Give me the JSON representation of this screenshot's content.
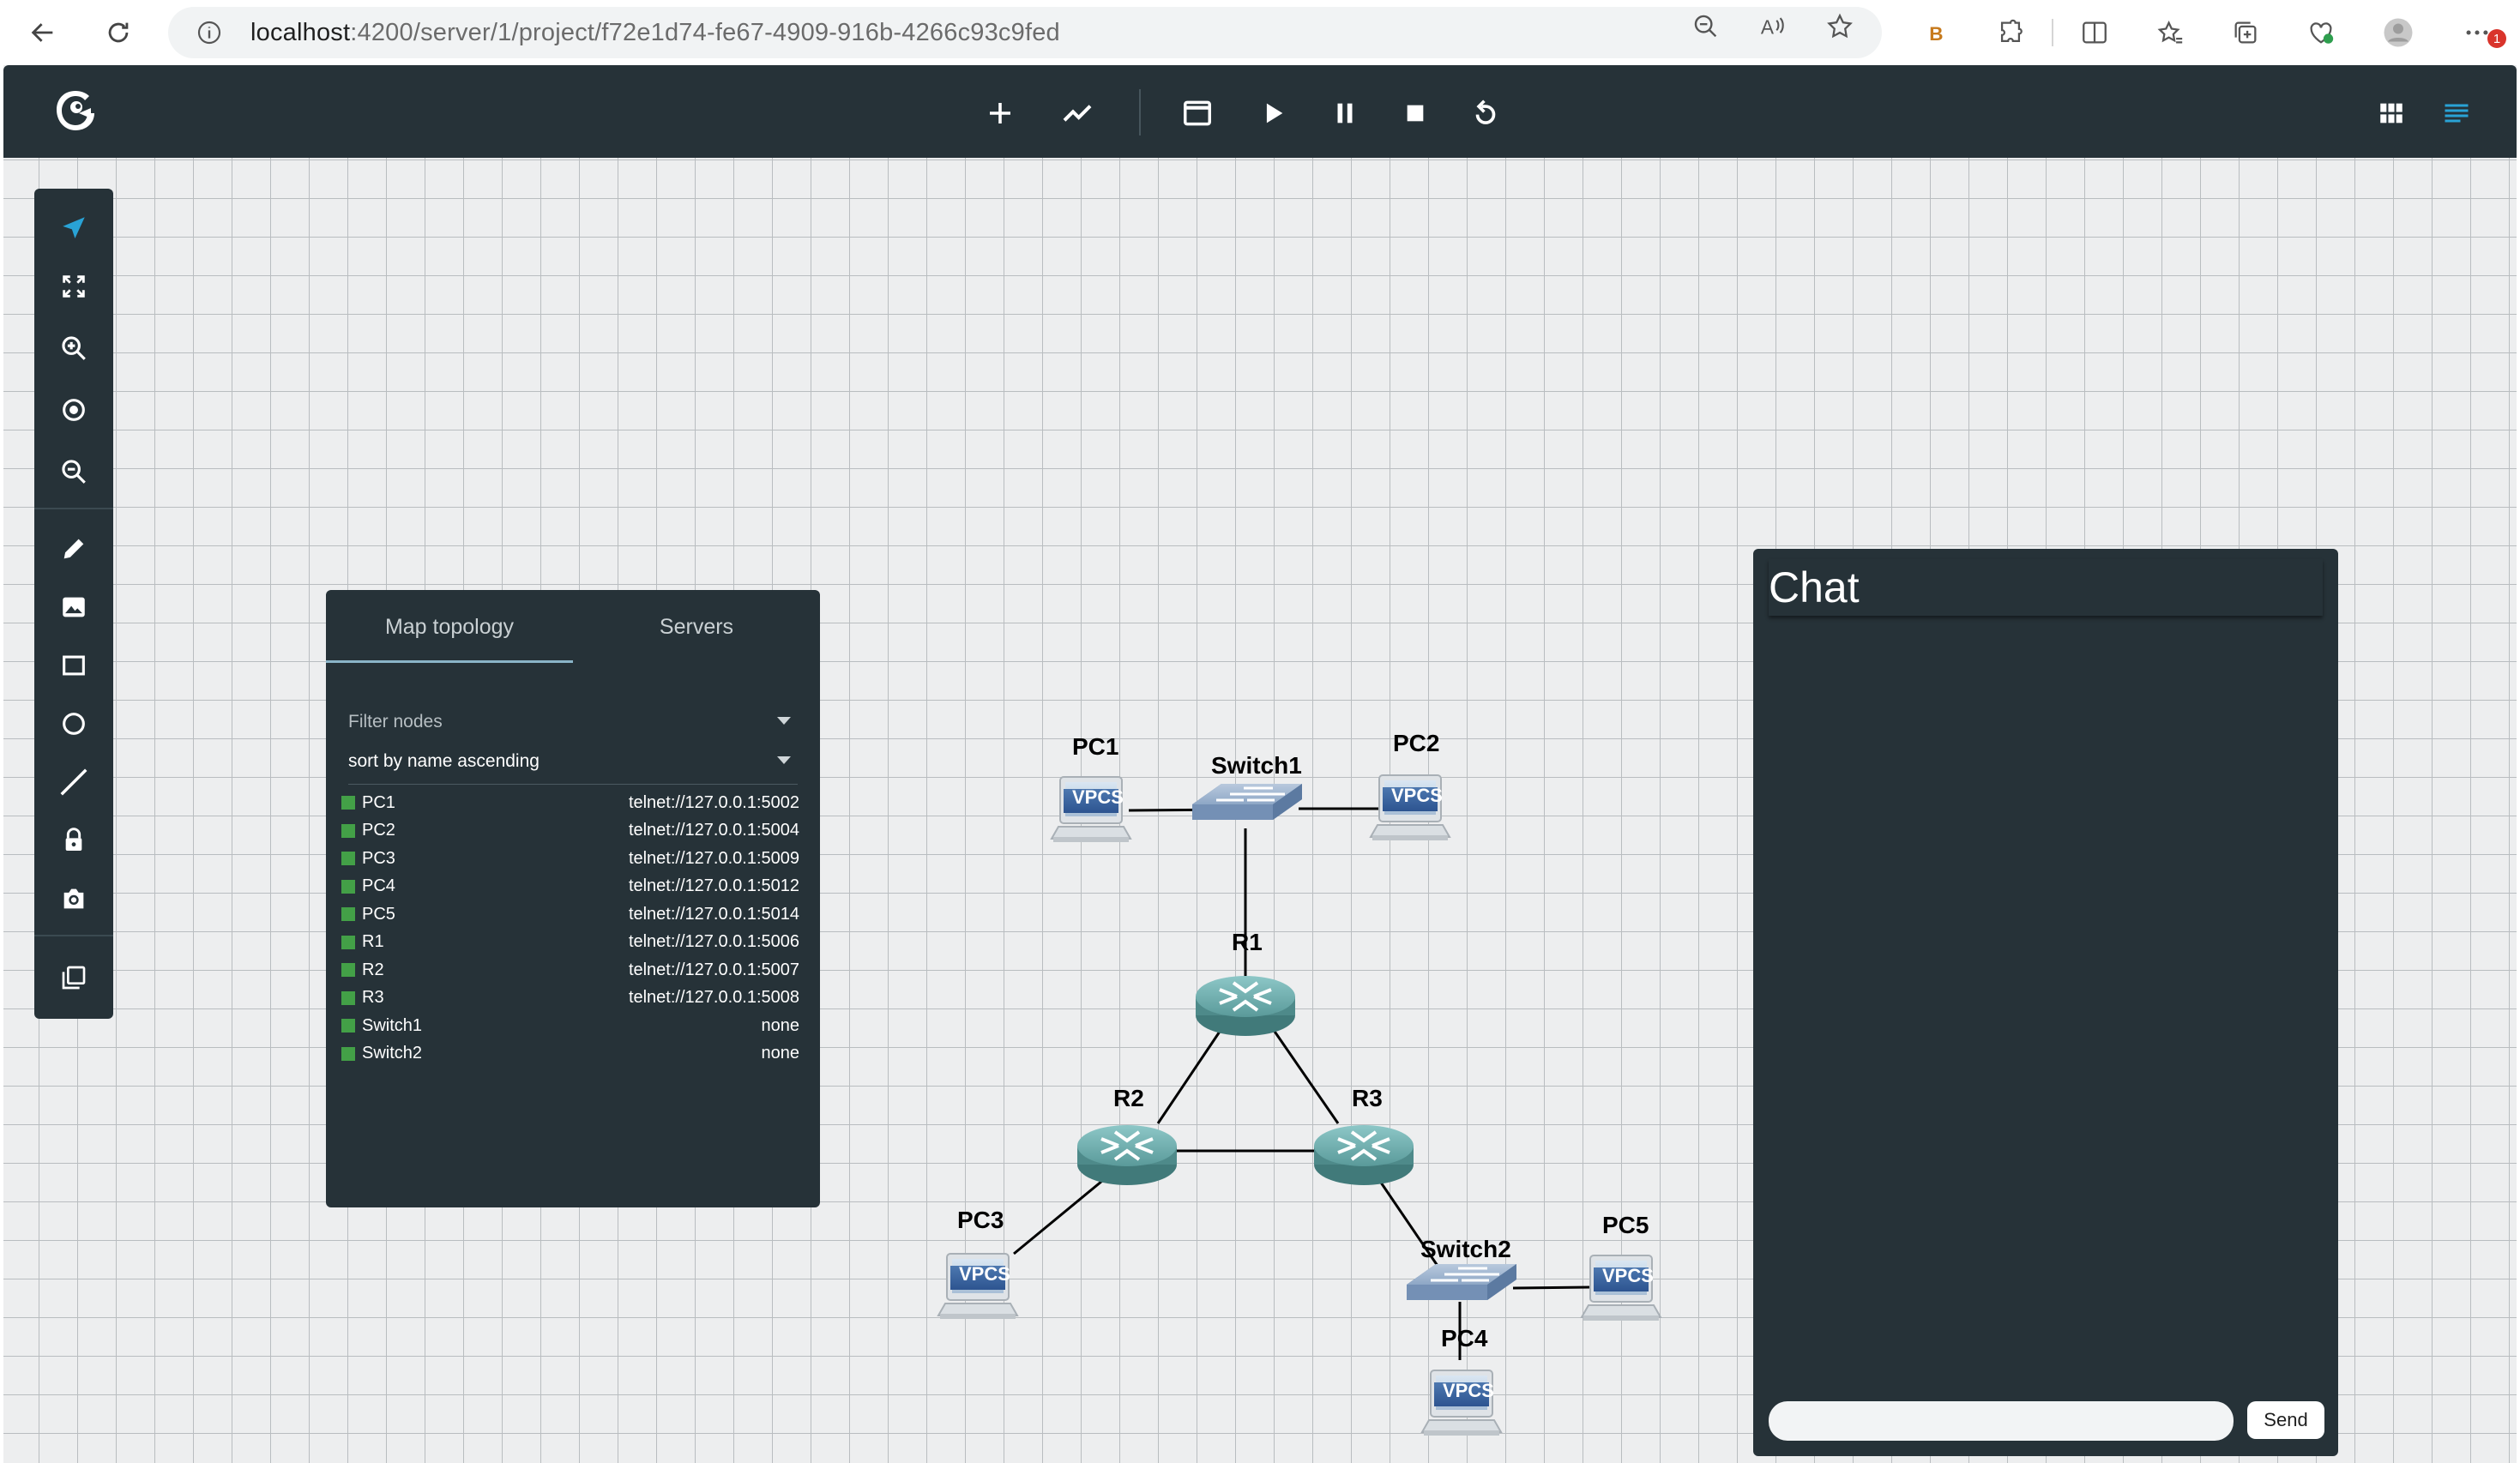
{
  "browser": {
    "url_host": "localhost",
    "url_path": ":4200/server/1/project/f72e1d74-fe67-4909-916b-4266c93c9fed",
    "notification_count": "1"
  },
  "toolbar": {
    "items": [
      "add-node",
      "add-link",
      "console",
      "start",
      "pause",
      "stop",
      "reload"
    ]
  },
  "topology_panel": {
    "tabs": [
      "Map topology",
      "Servers"
    ],
    "filter_placeholder": "Filter nodes",
    "sort_value": "sort by name ascending",
    "nodes": [
      {
        "name": "PC1",
        "console": "telnet://127.0.0.1:5002"
      },
      {
        "name": "PC2",
        "console": "telnet://127.0.0.1:5004"
      },
      {
        "name": "PC3",
        "console": "telnet://127.0.0.1:5009"
      },
      {
        "name": "PC4",
        "console": "telnet://127.0.0.1:5012"
      },
      {
        "name": "PC5",
        "console": "telnet://127.0.0.1:5014"
      },
      {
        "name": "R1",
        "console": "telnet://127.0.0.1:5006"
      },
      {
        "name": "R2",
        "console": "telnet://127.0.0.1:5007"
      },
      {
        "name": "R3",
        "console": "telnet://127.0.0.1:5008"
      },
      {
        "name": "Switch1",
        "console": "none"
      },
      {
        "name": "Switch2",
        "console": "none"
      }
    ],
    "status_color": "#43a047"
  },
  "chat": {
    "title": "Chat",
    "send_label": "Send"
  },
  "topology": {
    "labels": {
      "PC1": "PC1",
      "PC2": "PC2",
      "PC3": "PC3",
      "PC4": "PC4",
      "PC5": "PC5",
      "R1": "R1",
      "R2": "R2",
      "R3": "R3",
      "Switch1": "Switch1",
      "Switch2": "Switch2"
    },
    "vpcs_text": "VPCS"
  },
  "colors": {
    "app_bar": "#263238",
    "panel": "#263238",
    "accent": "#29a3d6",
    "router": "#5a9a9a",
    "switch": "#7f98bb"
  }
}
